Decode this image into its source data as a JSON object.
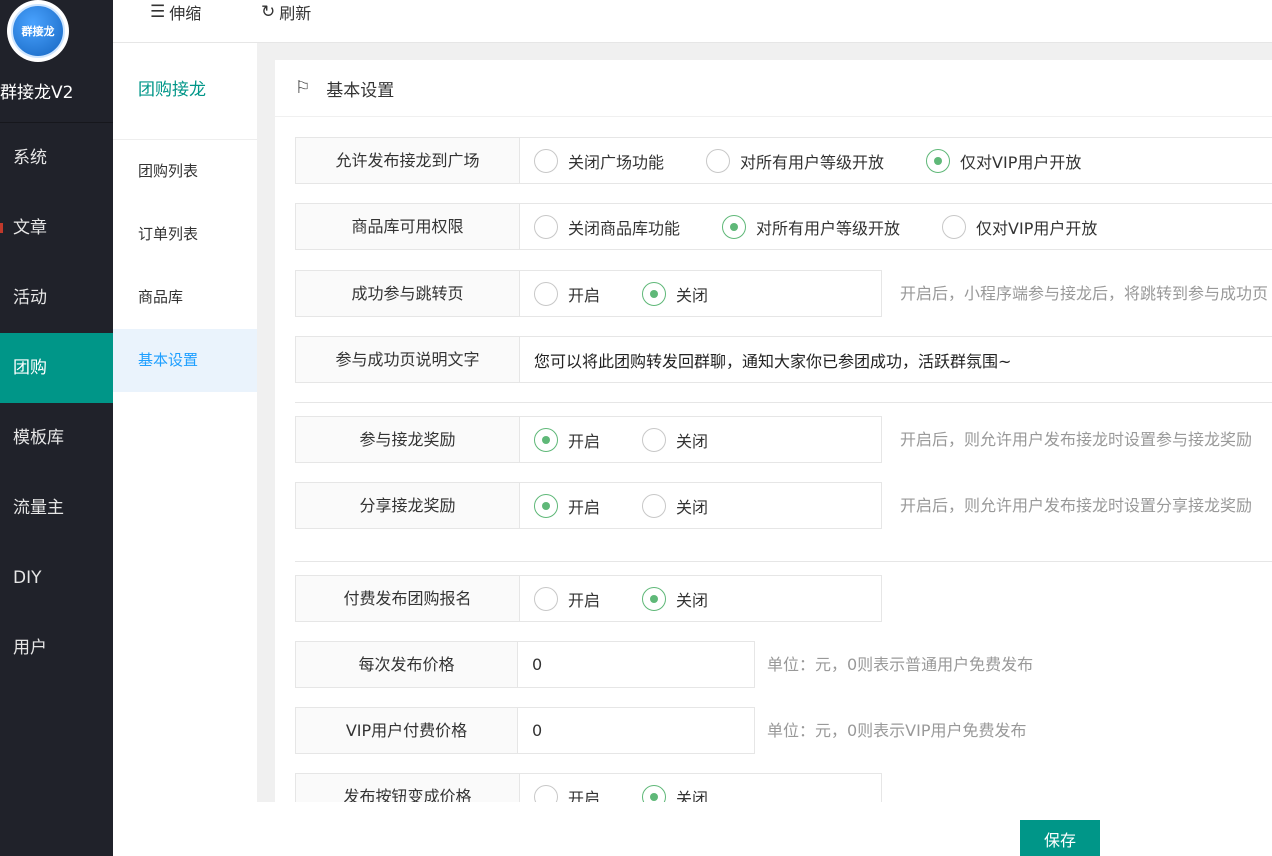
{
  "sidebar": {
    "logo_text": "群接龙",
    "app_name": "群接龙V2",
    "items": [
      {
        "label": "系统"
      },
      {
        "label": "文章"
      },
      {
        "label": "活动"
      },
      {
        "label": "团购"
      },
      {
        "label": "模板库"
      },
      {
        "label": "流量主"
      },
      {
        "label": "DIY"
      },
      {
        "label": "用户"
      }
    ]
  },
  "topbar": {
    "collapse_label": "伸缩",
    "refresh_label": "刷新"
  },
  "submenu": {
    "title": "团购接龙",
    "items": [
      {
        "label": "团购列表"
      },
      {
        "label": "订单列表"
      },
      {
        "label": "商品库"
      },
      {
        "label": "基本设置"
      }
    ]
  },
  "main": {
    "header_title": "基本设置",
    "rows": [
      {
        "label": "允许发布接龙到广场",
        "options": [
          "关闭广场功能",
          "对所有用户等级开放",
          "仅对VIP用户开放"
        ],
        "selected": 2
      },
      {
        "label": "商品库可用权限",
        "options": [
          "关闭商品库功能",
          "对所有用户等级开放",
          "仅对VIP用户开放"
        ],
        "selected": 1
      },
      {
        "label": "成功参与跳转页",
        "options": [
          "开启",
          "关闭"
        ],
        "selected": 1,
        "hint": "开启后，小程序端参与接龙后，将跳转到参与成功页"
      },
      {
        "label": "参与成功页说明文字",
        "value": "您可以将此团购转发回群聊，通知大家你已参团成功，活跃群氛围~"
      },
      {
        "label": "参与接龙奖励",
        "options": [
          "开启",
          "关闭"
        ],
        "selected": 0,
        "hint": "开启后，则允许用户发布接龙时设置参与接龙奖励"
      },
      {
        "label": "分享接龙奖励",
        "options": [
          "开启",
          "关闭"
        ],
        "selected": 0,
        "hint": "开启后，则允许用户发布接龙时设置分享接龙奖励"
      },
      {
        "label": "付费发布团购报名",
        "options": [
          "开启",
          "关闭"
        ],
        "selected": 1
      },
      {
        "label": "每次发布价格",
        "value": "0",
        "hint": "单位：元，0则表示普通用户免费发布"
      },
      {
        "label": "VIP用户付费价格",
        "value": "0",
        "hint": "单位：元，0则表示VIP用户免费发布"
      },
      {
        "label": "发布按钮变成价格",
        "options": [
          "开启",
          "关闭"
        ],
        "selected": 1
      }
    ]
  },
  "footer": {
    "save_label": "保存"
  },
  "colors": {
    "sidebar_bg": "#20222a",
    "accent": "#009688",
    "radio_on": "#5fb878",
    "link": "#1e9fff"
  }
}
